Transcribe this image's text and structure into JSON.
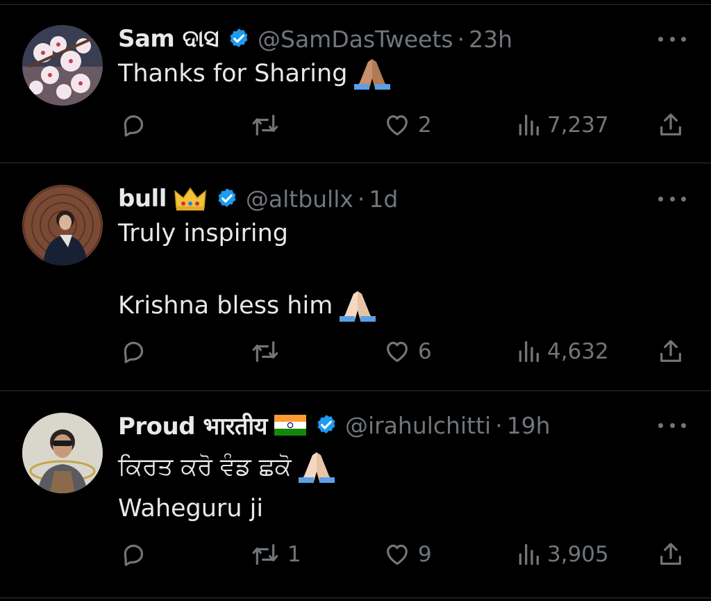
{
  "tweets": [
    {
      "name": "Sam ଦାସ",
      "handle": "@SamDasTweets",
      "time": "23h",
      "body": [
        "Thanks for Sharing"
      ],
      "replies": "",
      "reposts": "",
      "likes": "2",
      "views": "7,237"
    },
    {
      "name": "bull",
      "handle": "@altbullx",
      "time": "1d",
      "body": [
        "Truly inspiring",
        "",
        "Krishna bless him"
      ],
      "replies": "",
      "reposts": "",
      "likes": "6",
      "views": "4,632"
    },
    {
      "name": "Proud भारतीय",
      "handle": "@irahulchitti",
      "time": "19h",
      "body": [
        "ਕਿਰਤ ਕਰੋ ਵੰਡ ਛਕੋ",
        "Waheguru ji"
      ],
      "replies": "",
      "reposts": "1",
      "likes": "9",
      "views": "3,905"
    }
  ],
  "separator": "·",
  "colors": {
    "background": "#000000",
    "text": "#e7e9ea",
    "muted": "#71767b",
    "verified": "#1d9bf0",
    "divider": "#2f3336"
  },
  "icons": [
    "verified-icon",
    "more-icon",
    "reply-icon",
    "repost-icon",
    "like-icon",
    "views-icon",
    "share-icon",
    "folded-hands-emoji",
    "crown-emoji",
    "india-flag-emoji"
  ]
}
